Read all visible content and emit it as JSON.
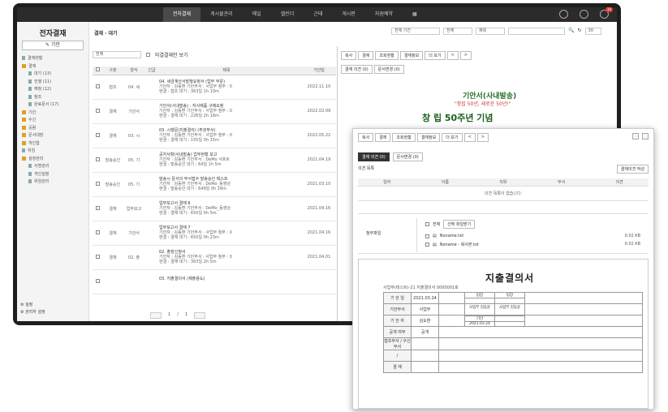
{
  "app": {
    "title": "전자결재"
  },
  "topnav": [
    "전자결재",
    "게시물관리",
    "메일",
    "캘린더",
    "근태",
    "게시판",
    "자원예약"
  ],
  "topbar": {
    "notification_count": "10"
  },
  "sidebar": {
    "title": "전자결재",
    "draft_button": "기안",
    "tree": [
      {
        "label": "결재현황",
        "level": 1,
        "type": "doc"
      },
      {
        "label": "결재",
        "level": 1,
        "type": "folder"
      },
      {
        "label": "대기 (13)",
        "level": 2,
        "type": "doc"
      },
      {
        "label": "진행 (11)",
        "level": 2,
        "type": "doc"
      },
      {
        "label": "예정 (12)",
        "level": 2,
        "type": "doc"
      },
      {
        "label": "참조",
        "level": 2,
        "type": "doc"
      },
      {
        "label": "완료문서 (17)",
        "level": 2,
        "type": "doc"
      },
      {
        "label": "기안",
        "level": 1,
        "type": "folder"
      },
      {
        "label": "수신",
        "level": 1,
        "type": "folder"
      },
      {
        "label": "공람",
        "level": 1,
        "type": "folder"
      },
      {
        "label": "문서대장",
        "level": 1,
        "type": "folder"
      },
      {
        "label": "개인함",
        "level": 1,
        "type": "folder"
      },
      {
        "label": "위임",
        "level": 1,
        "type": "doc"
      },
      {
        "label": "설정관리",
        "level": 1,
        "type": "folder"
      },
      {
        "label": "서명관리",
        "level": 2,
        "type": "doc"
      },
      {
        "label": "개인설정",
        "level": 2,
        "type": "doc"
      },
      {
        "label": "위임관리",
        "level": 2,
        "type": "doc"
      }
    ],
    "bottom": [
      "설정",
      "관리자 설정"
    ]
  },
  "main": {
    "breadcrumb": "결재 · 대기",
    "search": {
      "period": "전체 기간",
      "type": "전체",
      "field": "제목",
      "page_size": "30"
    },
    "filter": {
      "select": "전체",
      "checkbox": "미결결재만 보기"
    },
    "columns": [
      "구분",
      "양식",
      "긴급",
      "제목",
      "",
      "기안일"
    ],
    "rows": [
      {
        "type": "협조",
        "form": "04. 세",
        "subject": "04. 세금계산서발행요청서 (업무 부문)",
        "line2": "기안자 : 김동환  기안부서 : 사업부  첨부 : 0",
        "line3": "현결 : 협조 대기 : 363일 1h 10m",
        "date": "2022.11.10"
      },
      {
        "type": "결재",
        "form": "기안서",
        "subject": "기안서(사내발송) : 자사제품 구매요청",
        "line2": "기안자 : 김동환  기안부서 : 사업부  첨부 : 0",
        "line3": "현결 : 결재 대기 : 226일 2h 18m",
        "date": "2022.02.09"
      },
      {
        "type": "결재",
        "form": "03. 시",
        "subject": "03. 시행문(지출결의) (주관부서)",
        "line2": "기안자 : 김동환  기안부서 : 사업부  첨부 : 0",
        "line3": "현결 : 결재 대기 : 155일 3h 15m",
        "date": "2022.05.22"
      },
      {
        "type": "발송승인",
        "form": "05. 기",
        "subject": "공지사항(사내발송) 업무현황 보고",
        "line2": "기안자 : 김동환  기안부서 : DeMo 서포트",
        "line3": "현결 : 발송승인 대기 : 64일 1h 5m",
        "date": "2021.04.19"
      },
      {
        "type": "발송승인",
        "form": "05. 기",
        "subject": "발송시 문서의 부서접수 발송승인 테스트",
        "line2": "기안자 : 김동환  기안부서 : DeMo_동영상",
        "line3": "현결 : 발송승인 대기 : 649일 0h 16m",
        "date": "2021.03.10"
      },
      {
        "type": "결재",
        "form": "업무보고",
        "subject": "업무보고서 결재 6",
        "line2": "기안자 : 김동환  기안부서 : DeMo_동영상",
        "line3": "현결 : 결재 대기 : 650일 0h 5m",
        "date": "2021.04.16"
      },
      {
        "type": "결재",
        "form": "기안서",
        "subject": "업무보고서 결재 7",
        "line2": "기안자 : 김동환  기안부서 : 사업부  첨부 : 0",
        "line3": "현결 : 결재 대기 : 650일 0h 23m",
        "date": "2021.04.16"
      },
      {
        "type": "결재",
        "form": "02. 출",
        "subject": "02. 출장신청서",
        "line2": "기안자 : 김동환  기안부서 : 사업부  첨부 : 0",
        "line3": "현결 : 결재 대기 : 363일 2h 5m",
        "date": "2021.04.01"
      },
      {
        "type": "",
        "form": "",
        "subject": "03. 지출결의서 (제출용도)",
        "line2": "",
        "line3": "",
        "date": ""
      }
    ],
    "pager": {
      "current": "1",
      "total": "1"
    }
  },
  "preview": {
    "tabs": [
      "복사",
      "결재",
      "조회현황",
      "결재정보",
      "더 보기",
      "<",
      ">"
    ],
    "sub_tabs": [
      "결재 의견 (0)",
      "문서변경 (0)"
    ],
    "banner_title": "기안서(사내발송)",
    "banner_sub": "\"창립 50년, 새로운 50년!\"",
    "banner_line": "창 립 50주년 기념"
  },
  "popup": {
    "tabs": [
      "복사",
      "결재",
      "조회현황",
      "결재정보",
      "더 보기",
      "<",
      ">"
    ],
    "sub_tabs": [
      "결재 의견 (0)",
      "문서변경 (0)"
    ],
    "section_label": "의견 목록",
    "action_button": "결재의견 작성",
    "op_columns": [
      "일자",
      "이름",
      "직위",
      "부서",
      "의견"
    ],
    "op_empty": "의견 목록이 없습니다.",
    "attach_label": "첨부파일",
    "attach_select": "선택 파일받기",
    "attach_all": "전체",
    "files": [
      {
        "name": "Noname.txt",
        "size": "0.02 KB"
      },
      {
        "name": "Noname - 복사본.txt",
        "size": "0.02 KB"
      }
    ],
    "doc": {
      "title": "지출결의서",
      "meta": "사업부(테스트)-21 지출결의서 0000001호",
      "fields": [
        {
          "label": "기 안 일",
          "value": "2021.03.24"
        },
        {
          "label": "기안부서",
          "value": "사업부"
        },
        {
          "label": "기 안 자",
          "value": "김도환"
        },
        {
          "label": "공개 여부",
          "value": "공개"
        },
        {
          "label": "협조부서 / 수신부서",
          "value": ""
        },
        {
          "label": "/",
          "value": ""
        },
        {
          "label": "결  재",
          "value": ""
        }
      ],
      "approval": {
        "head": [
          "팀장",
          "팀장"
        ],
        "names": [
          "사업부 김동윤",
          "사업부 김동윤"
        ],
        "stamp": "기안",
        "date": "2021.03.24"
      }
    }
  }
}
